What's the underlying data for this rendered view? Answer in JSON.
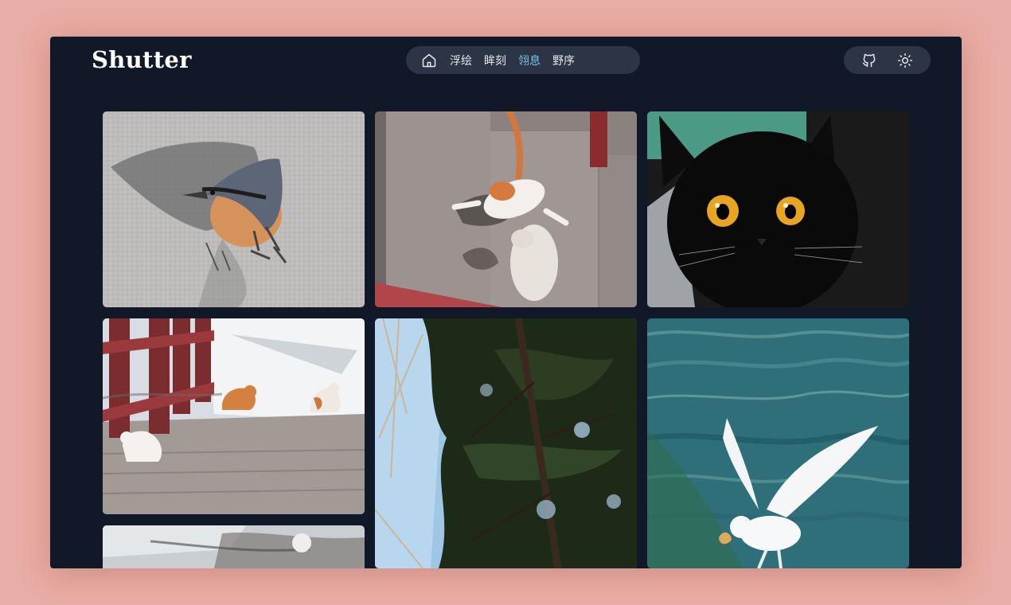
{
  "app": {
    "brand": "Shutter"
  },
  "nav": {
    "home_icon": "home-icon",
    "items": [
      {
        "label": "浮绘",
        "active": false
      },
      {
        "label": "眸刻",
        "active": false
      },
      {
        "label": "翎息",
        "active": true
      },
      {
        "label": "野序",
        "active": false
      }
    ]
  },
  "tools": {
    "github_icon": "github-icon",
    "theme_icon": "sun-icon"
  },
  "colors": {
    "page_background": "#e8ada4",
    "window_background": "#111827",
    "pill_background": "#2b3545",
    "nav_text": "#e5e7eb",
    "nav_active": "#7dc3ea"
  },
  "gallery": {
    "photos": [
      {
        "subject": "nuthatch on pavement"
      },
      {
        "subject": "two cats on stone steps"
      },
      {
        "subject": "black cat with amber eyes"
      },
      {
        "subject": "cats near red railing on snowy steps"
      },
      {
        "subject": "evergreen tree against blue sky"
      },
      {
        "subject": "white gull over water"
      },
      {
        "subject": "snowy ground"
      }
    ]
  }
}
